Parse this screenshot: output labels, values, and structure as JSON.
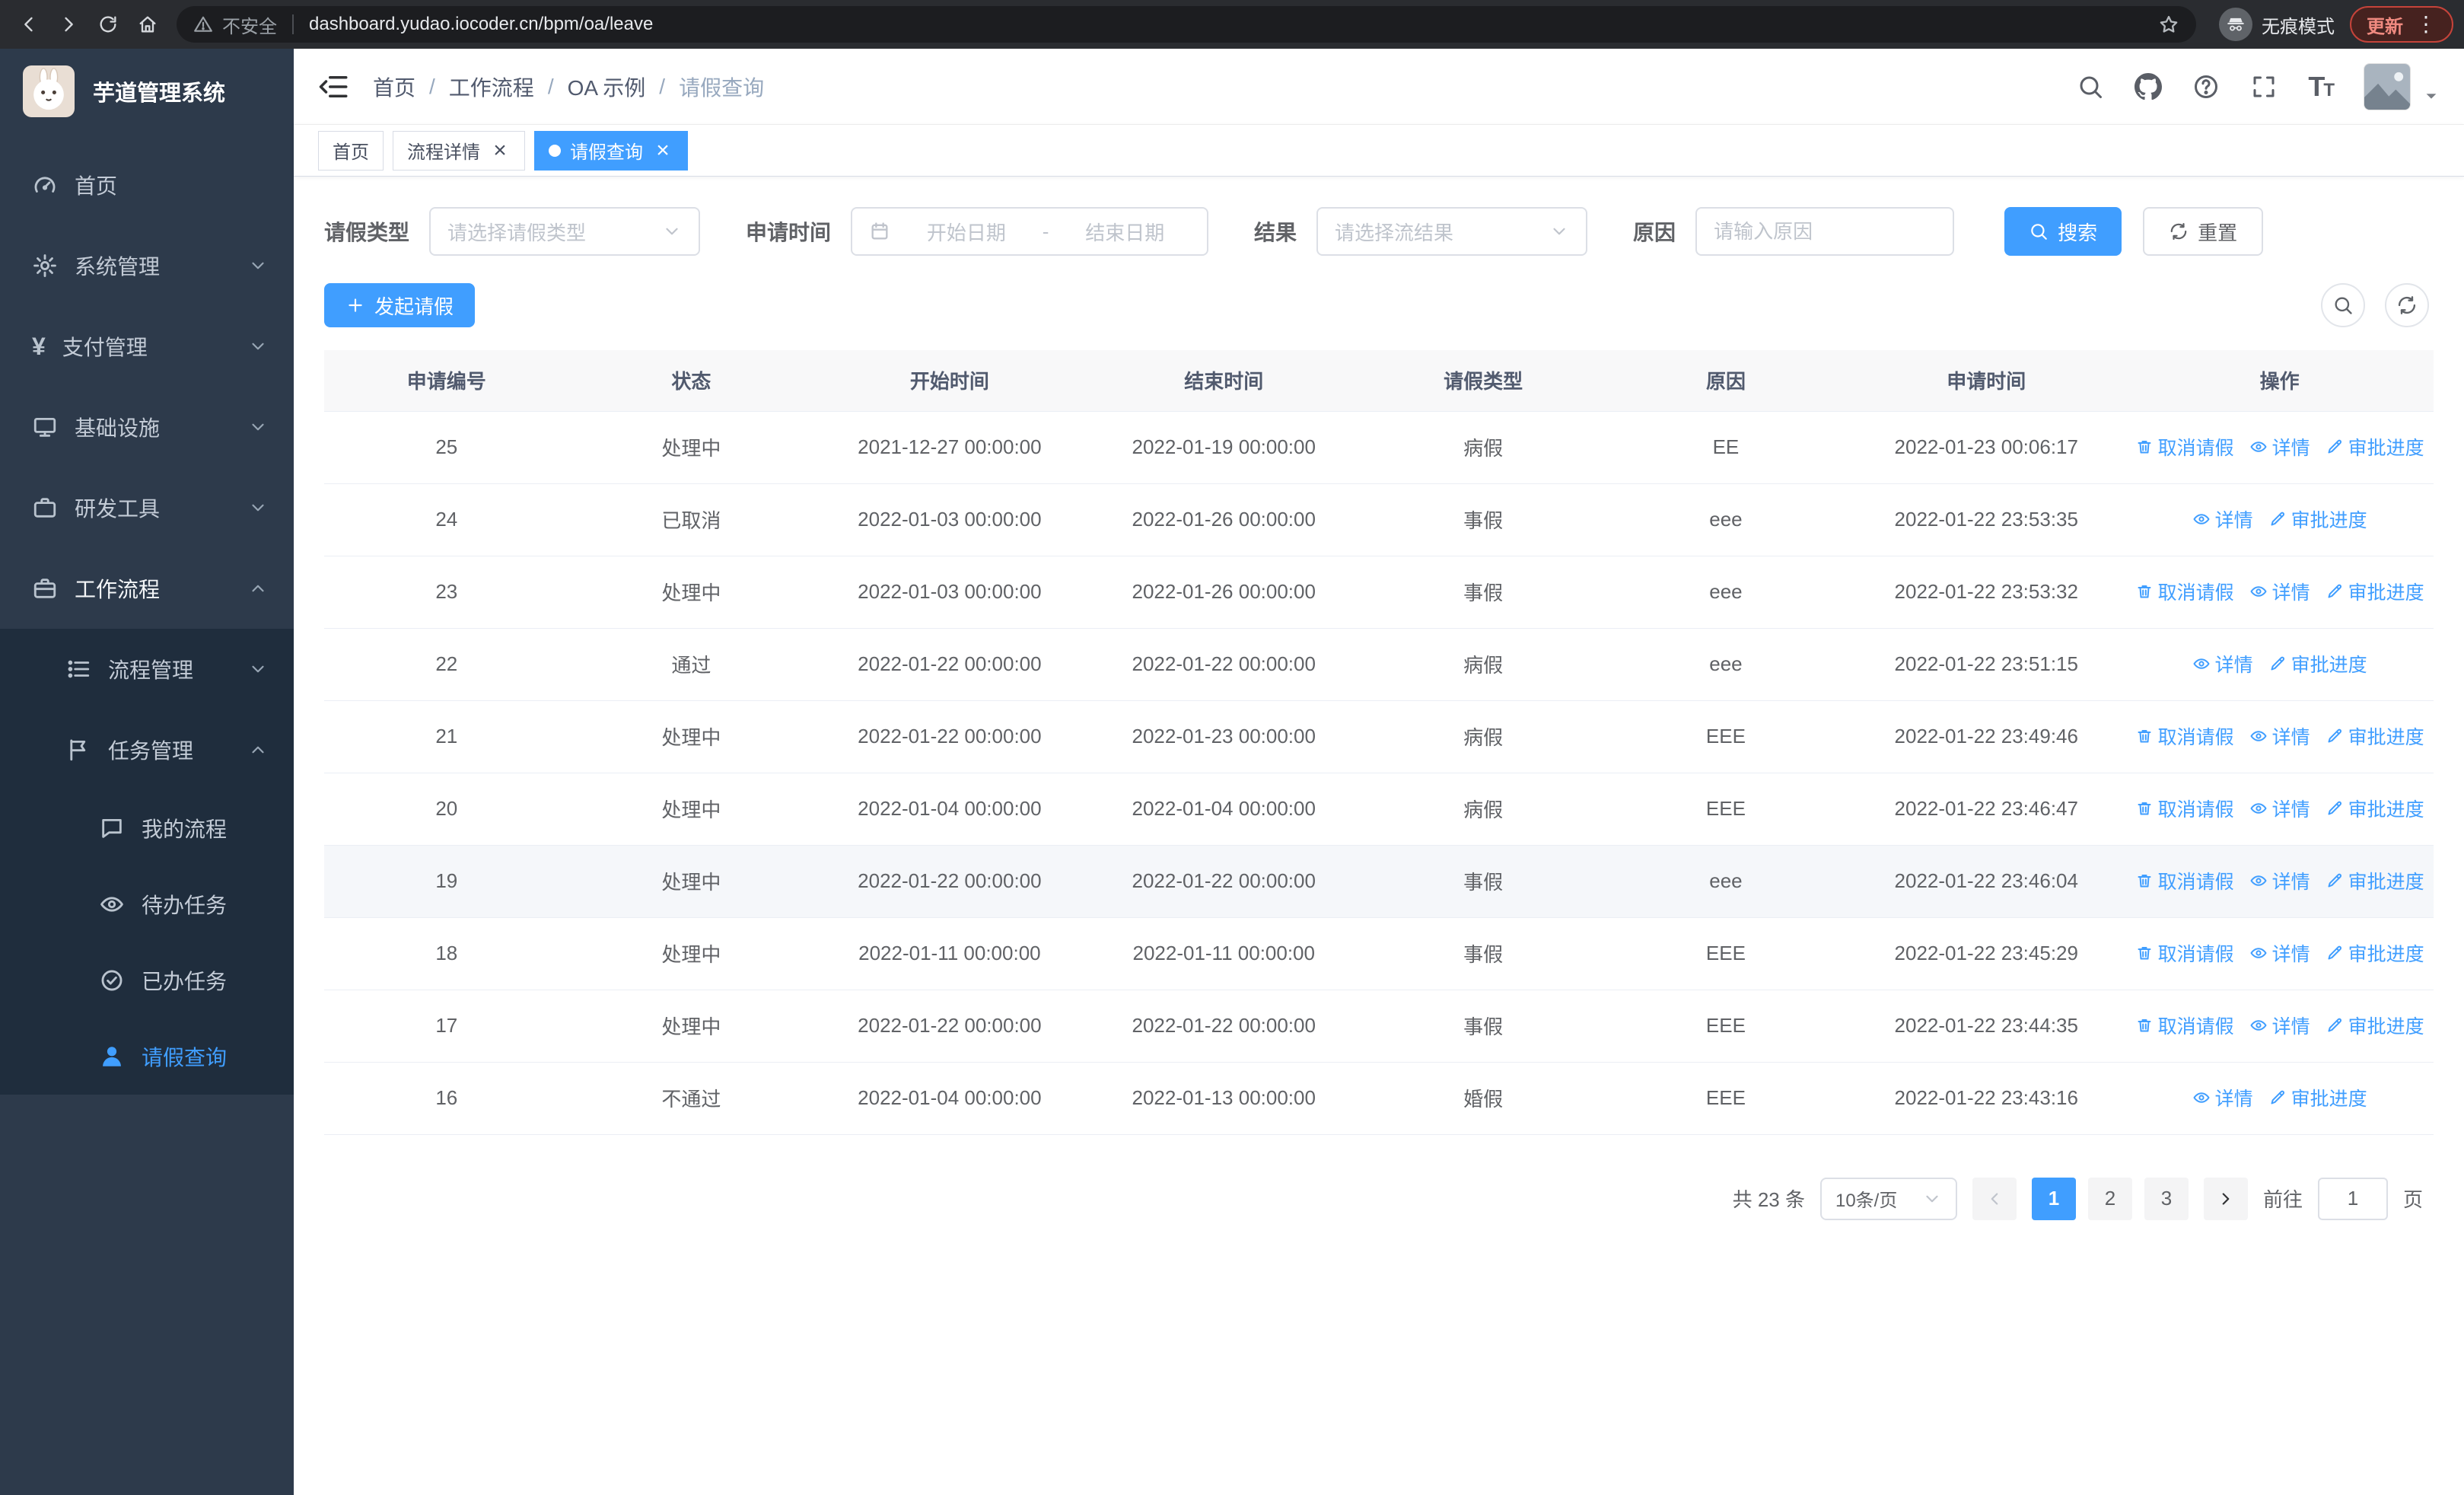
{
  "browser": {
    "security_label": "不安全",
    "url": "dashboard.yudao.iocoder.cn/bpm/oa/leave",
    "incognito_label": "无痕模式",
    "update_label": "更新"
  },
  "icons": {
    "close": "×",
    "menu_dots": "⋮",
    "yen": "¥"
  },
  "sidebar": {
    "logo_title": "芋道管理系统",
    "menu": [
      {
        "key": "home",
        "label": "首页",
        "icon": "dashboard-icon"
      },
      {
        "key": "system",
        "label": "系统管理",
        "icon": "gear-icon",
        "expandable": true
      },
      {
        "key": "payment",
        "label": "支付管理",
        "icon": "yen-icon",
        "expandable": true
      },
      {
        "key": "infrastructure",
        "label": "基础设施",
        "icon": "monitor-icon",
        "expandable": true
      },
      {
        "key": "dev-tools",
        "label": "研发工具",
        "icon": "toolbox-icon",
        "expandable": true
      },
      {
        "key": "workflow",
        "label": "工作流程",
        "icon": "briefcase-icon",
        "expandable": true,
        "expanded": true,
        "highlight": true,
        "children": [
          {
            "key": "process-management",
            "label": "流程管理",
            "icon": "list-icon",
            "expandable": true
          },
          {
            "key": "task-management",
            "label": "任务管理",
            "icon": "flag-icon",
            "expandable": true,
            "expanded": true,
            "children": [
              {
                "key": "my-process",
                "label": "我的流程",
                "icon": "chat-icon"
              },
              {
                "key": "todo-tasks",
                "label": "待办任务",
                "icon": "eye-icon"
              },
              {
                "key": "done-tasks",
                "label": "已办任务",
                "icon": "check-icon"
              },
              {
                "key": "leave-query",
                "label": "请假查询",
                "icon": "user-icon",
                "active": true
              }
            ]
          }
        ]
      }
    ]
  },
  "header": {
    "breadcrumbs": [
      "首页",
      "工作流程",
      "OA 示例",
      "请假查询"
    ],
    "separator": "/"
  },
  "tabs": [
    {
      "key": "home",
      "label": "首页"
    },
    {
      "key": "process-detail",
      "label": "流程详情",
      "closable": true
    },
    {
      "key": "leave-query",
      "label": "请假查询",
      "closable": true,
      "active": true
    }
  ],
  "filters": {
    "leave_type_label": "请假类型",
    "leave_type_placeholder": "请选择请假类型",
    "apply_time_label": "申请时间",
    "start_date_placeholder": "开始日期",
    "date_separator": "-",
    "end_date_placeholder": "结束日期",
    "result_label": "结果",
    "result_placeholder": "请选择流结果",
    "reason_label": "原因",
    "reason_placeholder": "请输入原因",
    "search_label": "搜索",
    "reset_label": "重置"
  },
  "toolbar": {
    "create_label": "发起请假"
  },
  "table": {
    "columns": [
      "申请编号",
      "状态",
      "开始时间",
      "结束时间",
      "请假类型",
      "原因",
      "申请时间",
      "操作"
    ],
    "action_labels": {
      "cancel": "取消请假",
      "detail": "详情",
      "progress": "审批进度"
    },
    "rows": [
      {
        "id": "25",
        "status": "处理中",
        "start": "2021-12-27 00:00:00",
        "end": "2022-01-19 00:00:00",
        "type": "病假",
        "reason": "EE",
        "apply_time": "2022-01-23 00:06:17",
        "actions": [
          "cancel",
          "detail",
          "progress"
        ]
      },
      {
        "id": "24",
        "status": "已取消",
        "start": "2022-01-03 00:00:00",
        "end": "2022-01-26 00:00:00",
        "type": "事假",
        "reason": "eee",
        "apply_time": "2022-01-22 23:53:35",
        "actions": [
          "detail",
          "progress"
        ]
      },
      {
        "id": "23",
        "status": "处理中",
        "start": "2022-01-03 00:00:00",
        "end": "2022-01-26 00:00:00",
        "type": "事假",
        "reason": "eee",
        "apply_time": "2022-01-22 23:53:32",
        "actions": [
          "cancel",
          "detail",
          "progress"
        ]
      },
      {
        "id": "22",
        "status": "通过",
        "start": "2022-01-22 00:00:00",
        "end": "2022-01-22 00:00:00",
        "type": "病假",
        "reason": "eee",
        "apply_time": "2022-01-22 23:51:15",
        "actions": [
          "detail",
          "progress"
        ]
      },
      {
        "id": "21",
        "status": "处理中",
        "start": "2022-01-22 00:00:00",
        "end": "2022-01-23 00:00:00",
        "type": "病假",
        "reason": "EEE",
        "apply_time": "2022-01-22 23:49:46",
        "actions": [
          "cancel",
          "detail",
          "progress"
        ]
      },
      {
        "id": "20",
        "status": "处理中",
        "start": "2022-01-04 00:00:00",
        "end": "2022-01-04 00:00:00",
        "type": "病假",
        "reason": "EEE",
        "apply_time": "2022-01-22 23:46:47",
        "actions": [
          "cancel",
          "detail",
          "progress"
        ]
      },
      {
        "id": "19",
        "status": "处理中",
        "start": "2022-01-22 00:00:00",
        "end": "2022-01-22 00:00:00",
        "type": "事假",
        "reason": "eee",
        "apply_time": "2022-01-22 23:46:04",
        "actions": [
          "cancel",
          "detail",
          "progress"
        ],
        "highlighted": true
      },
      {
        "id": "18",
        "status": "处理中",
        "start": "2022-01-11 00:00:00",
        "end": "2022-01-11 00:00:00",
        "type": "事假",
        "reason": "EEE",
        "apply_time": "2022-01-22 23:45:29",
        "actions": [
          "cancel",
          "detail",
          "progress"
        ]
      },
      {
        "id": "17",
        "status": "处理中",
        "start": "2022-01-22 00:00:00",
        "end": "2022-01-22 00:00:00",
        "type": "事假",
        "reason": "EEE",
        "apply_time": "2022-01-22 23:44:35",
        "actions": [
          "cancel",
          "detail",
          "progress"
        ]
      },
      {
        "id": "16",
        "status": "不通过",
        "start": "2022-01-04 00:00:00",
        "end": "2022-01-13 00:00:00",
        "type": "婚假",
        "reason": "EEE",
        "apply_time": "2022-01-22 23:43:16",
        "actions": [
          "detail",
          "progress"
        ]
      }
    ]
  },
  "pagination": {
    "total_label": "共 23 条",
    "page_size_label": "10条/页",
    "pages": [
      "1",
      "2",
      "3"
    ],
    "active_page": "1",
    "goto_label": "前往",
    "goto_value": "1",
    "goto_unit_label": "页"
  }
}
